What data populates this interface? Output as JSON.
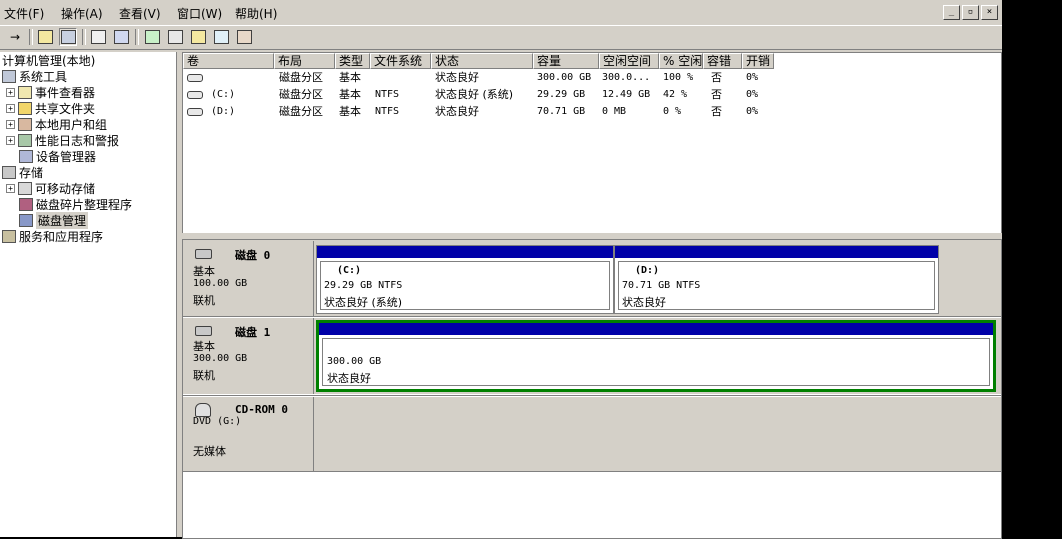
{
  "menu": {
    "items": [
      "文件(F)",
      "操作(A)",
      "查看(V)",
      "窗口(W)",
      "帮助(H)"
    ],
    "window_buttons": [
      "_",
      "▫",
      "×"
    ]
  },
  "toolbar": {
    "buttons": [
      "back-icon",
      "up-icon",
      "show-tree-icon",
      "properties-icon",
      "help-icon",
      "refresh-icon",
      "export-icon",
      "open-icon",
      "search-icon",
      "settings-icon"
    ]
  },
  "tree": {
    "root": "计算机管理(本地)",
    "items": [
      {
        "label": "系统工具",
        "indent": 0,
        "expander": "−"
      },
      {
        "label": "事件查看器",
        "indent": 1,
        "expander": "+"
      },
      {
        "label": "共享文件夹",
        "indent": 1,
        "expander": "+"
      },
      {
        "label": "本地用户和组",
        "indent": 1,
        "expander": "+"
      },
      {
        "label": "性能日志和警报",
        "indent": 1,
        "expander": "+"
      },
      {
        "label": "设备管理器",
        "indent": 1,
        "expander": ""
      },
      {
        "label": "存储",
        "indent": 0,
        "expander": "−"
      },
      {
        "label": "可移动存储",
        "indent": 1,
        "expander": "+"
      },
      {
        "label": "磁盘碎片整理程序",
        "indent": 1,
        "expander": ""
      },
      {
        "label": "磁盘管理",
        "indent": 1,
        "expander": ""
      },
      {
        "label": "服务和应用程序",
        "indent": 0,
        "expander": "+"
      }
    ]
  },
  "volume_list": {
    "columns": [
      "卷",
      "布局",
      "类型",
      "文件系统",
      "状态",
      "容量",
      "空闲空间",
      "% 空闲",
      "容错",
      "开销"
    ],
    "rows": [
      [
        "",
        "磁盘分区",
        "基本",
        "",
        "状态良好",
        "300.00 GB",
        "300.0...",
        "100 %",
        "否",
        "0%"
      ],
      [
        "(C:)",
        "磁盘分区",
        "基本",
        "NTFS",
        "状态良好 (系统)",
        "29.29 GB",
        "12.49 GB",
        "42 %",
        "否",
        "0%"
      ],
      [
        "(D:)",
        "磁盘分区",
        "基本",
        "NTFS",
        "状态良好",
        "70.71 GB",
        "0 MB",
        "0 %",
        "否",
        "0%"
      ]
    ]
  },
  "disks": {
    "disk0": {
      "title": "磁盘 0",
      "type": "基本",
      "size": "100.00 GB",
      "state": "联机"
    },
    "disk1": {
      "title": "磁盘 1",
      "type": "基本",
      "size": "300.00 GB",
      "state": "联机"
    },
    "cdrom0": {
      "title": "CD-ROM 0",
      "type": "DVD (G:)",
      "media": "无媒体"
    }
  },
  "volumes": {
    "c": {
      "name": "(C:)",
      "size": "29.29 GB NTFS",
      "status": "状态良好 (系统)"
    },
    "d": {
      "name": "(D:)",
      "size": "70.71 GB NTFS",
      "status": "状态良好"
    },
    "disk1_part": {
      "size": "300.00 GB",
      "status": "状态良好"
    }
  },
  "colors": {
    "primary_partition": "#0000a8",
    "selected_border": "#008000",
    "chrome": "#d4d0c8"
  }
}
